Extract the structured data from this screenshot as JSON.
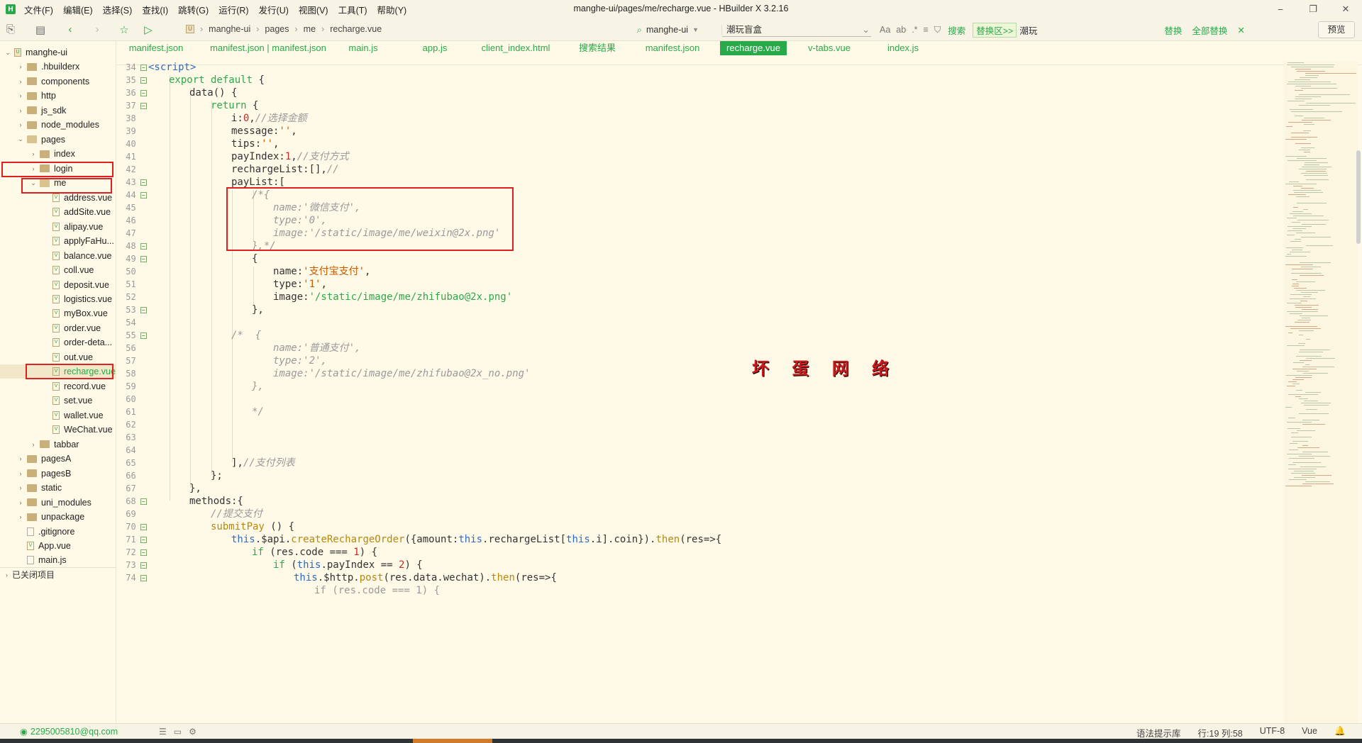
{
  "window": {
    "title": "manghe-ui/pages/me/recharge.vue - HBuilder X 3.2.16",
    "menus": [
      "文件(F)",
      "编辑(E)",
      "选择(S)",
      "查找(I)",
      "跳转(G)",
      "运行(R)",
      "发行(U)",
      "视图(V)",
      "工具(T)",
      "帮助(Y)"
    ],
    "controls": [
      "⎯",
      "❐",
      "✕"
    ]
  },
  "toolbar": {
    "breadcrumb": [
      "manghe-ui",
      "pages",
      "me",
      "recharge.vue"
    ],
    "search": {
      "scope": "manghe-ui",
      "term": "潮玩盲盒",
      "search_label": "搜索",
      "replace_area_label": "替换区>>",
      "replace_term": "潮玩",
      "replace_label": "替换",
      "replace_all_label": "全部替换"
    },
    "preview_label": "预览"
  },
  "sidebar": {
    "root": "manghe-ui",
    "items": [
      {
        "label": "manghe-ui",
        "kind": "project",
        "depth": 0,
        "open": true
      },
      {
        "label": ".hbuilderx",
        "kind": "folder",
        "depth": 1
      },
      {
        "label": "components",
        "kind": "folder",
        "depth": 1
      },
      {
        "label": "http",
        "kind": "folder",
        "depth": 1
      },
      {
        "label": "js_sdk",
        "kind": "folder",
        "depth": 1
      },
      {
        "label": "node_modules",
        "kind": "folder",
        "depth": 1
      },
      {
        "label": "pages",
        "kind": "folder",
        "depth": 1,
        "open": true
      },
      {
        "label": "index",
        "kind": "folder",
        "depth": 2
      },
      {
        "label": "login",
        "kind": "folder",
        "depth": 2
      },
      {
        "label": "me",
        "kind": "folder",
        "depth": 2,
        "open": true
      },
      {
        "label": "address.vue",
        "kind": "file",
        "depth": 3
      },
      {
        "label": "addSite.vue",
        "kind": "file",
        "depth": 3
      },
      {
        "label": "alipay.vue",
        "kind": "file",
        "depth": 3
      },
      {
        "label": "applyFaHu...",
        "kind": "file",
        "depth": 3
      },
      {
        "label": "balance.vue",
        "kind": "file",
        "depth": 3
      },
      {
        "label": "coll.vue",
        "kind": "file",
        "depth": 3
      },
      {
        "label": "deposit.vue",
        "kind": "file",
        "depth": 3
      },
      {
        "label": "logistics.vue",
        "kind": "file",
        "depth": 3
      },
      {
        "label": "myBox.vue",
        "kind": "file",
        "depth": 3
      },
      {
        "label": "order.vue",
        "kind": "file",
        "depth": 3
      },
      {
        "label": "order-deta...",
        "kind": "file",
        "depth": 3
      },
      {
        "label": "out.vue",
        "kind": "file",
        "depth": 3
      },
      {
        "label": "recharge.vue",
        "kind": "file",
        "depth": 3,
        "selected": true
      },
      {
        "label": "record.vue",
        "kind": "file",
        "depth": 3
      },
      {
        "label": "set.vue",
        "kind": "file",
        "depth": 3
      },
      {
        "label": "wallet.vue",
        "kind": "file",
        "depth": 3
      },
      {
        "label": "WeChat.vue",
        "kind": "file",
        "depth": 3
      },
      {
        "label": "tabbar",
        "kind": "folder",
        "depth": 2
      },
      {
        "label": "pagesA",
        "kind": "folder",
        "depth": 1
      },
      {
        "label": "pagesB",
        "kind": "folder",
        "depth": 1
      },
      {
        "label": "static",
        "kind": "folder",
        "depth": 1
      },
      {
        "label": "uni_modules",
        "kind": "folder",
        "depth": 1
      },
      {
        "label": "unpackage",
        "kind": "folder",
        "depth": 1
      },
      {
        "label": ".gitignore",
        "kind": "plain",
        "depth": 1
      },
      {
        "label": "App.vue",
        "kind": "file",
        "depth": 1
      },
      {
        "label": "main.js",
        "kind": "plain",
        "depth": 1
      }
    ],
    "closed_projects": "已关闭项目"
  },
  "tabs": [
    {
      "label": "manifest.json"
    },
    {
      "label": "manifest.json | manifest.json"
    },
    {
      "label": "main.js"
    },
    {
      "label": "app.js"
    },
    {
      "label": "client_index.html"
    },
    {
      "label": "搜索结果"
    },
    {
      "label": "manifest.json"
    },
    {
      "label": "recharge.vue",
      "active": true
    },
    {
      "label": "v-tabs.vue"
    },
    {
      "label": "index.js"
    }
  ],
  "editor": {
    "lines": [
      {
        "n": "34",
        "fold": "⊟"
      },
      {
        "n": "35",
        "fold": "⊟"
      },
      {
        "n": "36",
        "fold": "⊟"
      },
      {
        "n": "37",
        "fold": "⊟"
      },
      {
        "n": "38",
        "fold": ""
      },
      {
        "n": "39",
        "fold": ""
      },
      {
        "n": "40",
        "fold": ""
      },
      {
        "n": "41",
        "fold": ""
      },
      {
        "n": "42",
        "fold": ""
      },
      {
        "n": "43",
        "fold": "⊟"
      },
      {
        "n": "44",
        "fold": "⊟"
      },
      {
        "n": "45",
        "fold": ""
      },
      {
        "n": "46",
        "fold": ""
      },
      {
        "n": "47",
        "fold": ""
      },
      {
        "n": "48",
        "fold": "⊟"
      },
      {
        "n": "49",
        "fold": "⊟"
      },
      {
        "n": "50",
        "fold": ""
      },
      {
        "n": "51",
        "fold": ""
      },
      {
        "n": "52",
        "fold": ""
      },
      {
        "n": "53",
        "fold": "⊟"
      },
      {
        "n": "54",
        "fold": ""
      },
      {
        "n": "55",
        "fold": "⊟"
      },
      {
        "n": "56",
        "fold": ""
      },
      {
        "n": "57",
        "fold": ""
      },
      {
        "n": "58",
        "fold": ""
      },
      {
        "n": "59",
        "fold": ""
      },
      {
        "n": "60",
        "fold": ""
      },
      {
        "n": "61",
        "fold": ""
      },
      {
        "n": "62",
        "fold": ""
      },
      {
        "n": "63",
        "fold": ""
      },
      {
        "n": "64",
        "fold": ""
      },
      {
        "n": "65",
        "fold": ""
      },
      {
        "n": "66",
        "fold": ""
      },
      {
        "n": "67",
        "fold": ""
      },
      {
        "n": "68",
        "fold": "⊟"
      },
      {
        "n": "69",
        "fold": ""
      },
      {
        "n": "70",
        "fold": "⊟"
      },
      {
        "n": "71",
        "fold": "⊟"
      },
      {
        "n": "72",
        "fold": "⊟"
      },
      {
        "n": "73",
        "fold": "⊟"
      },
      {
        "n": "74",
        "fold": "⊟"
      }
    ],
    "code": {
      "l34": "<script>",
      "l35a": "export default",
      "l35b": " {",
      "l36": "data() {",
      "l37a": "return",
      "l37b": " {",
      "l38a": "i:",
      "l38b": "0",
      "l38c": ",",
      "l38d": "//选择金额",
      "l39a": "message:",
      "l39b": "''",
      "l39c": ",",
      "l40a": "tips:",
      "l40b": "''",
      "l40c": ",",
      "l41a": "payIndex:",
      "l41b": "1",
      "l41c": ",",
      "l41d": "//支付方式",
      "l42a": "rechargeList:[],",
      "l42b": "//",
      "l43": "payList:[",
      "l44": "/*{",
      "l45": "name:'微信支付',",
      "l46": "type:'0',",
      "l47": "image:'/static/image/me/weixin@2x.png'",
      "l48": "},*/",
      "l49": "{",
      "l50a": "name:",
      "l50b": "'支付宝支付'",
      "l50c": ",",
      "l51a": "type:",
      "l51b": "'1'",
      "l51c": ",",
      "l52a": "image:",
      "l52b": "'/static/image/me/zhifubao@2x.png'",
      "l53": "},",
      "l55": "/*  {",
      "l56": "name:'普通支付',",
      "l57": "type:'2',",
      "l58": "image:'/static/image/me/zhifubao@2x_no.png'",
      "l59": "},",
      "l61": "*/",
      "l65a": "],",
      "l65b": "//支付列表",
      "l66": "};",
      "l67": "},",
      "l68": "methods:{",
      "l69": "//提交支付",
      "l70a": "submitPay",
      "l70b": " () {",
      "l71a": "this",
      "l71b": ".$api.",
      "l71c": "createRechargeOrder",
      "l71d": "({amount:",
      "l71e": "this",
      "l71f": ".rechargeList[",
      "l71g": "this",
      "l71h": ".i].coin}).",
      "l71i": "then",
      "l71j": "(res=>{",
      "l72a": "if",
      "l72b": " (res.code === ",
      "l72c": "1",
      "l72d": ") {",
      "l73a": "if",
      "l73b": " (",
      "l73c": "this",
      "l73d": ".payIndex == ",
      "l73e": "2",
      "l73f": ") {",
      "l74a": "this",
      "l74b": ".$http.",
      "l74c": "post",
      "l74d": "(res.data.wechat).",
      "l74e": "then",
      "l74f": "(res=>{",
      "l75": "if (res.code === 1) {"
    },
    "watermark": "坏 蛋 网 络"
  },
  "statusbar": {
    "account": "2295005810@qq.com",
    "syntax_hint": "语法提示库",
    "position": "行:19  列:58",
    "encoding": "UTF-8",
    "language": "Vue"
  },
  "colors": {
    "accent": "#2aa94a",
    "background": "#fffae8",
    "highlight_box": "#e02020"
  }
}
